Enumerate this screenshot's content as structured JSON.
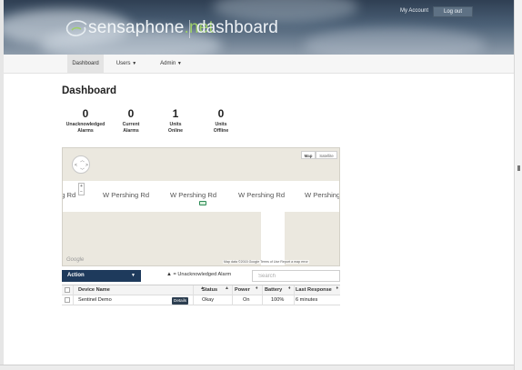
{
  "header": {
    "brand_name": "sensaphone",
    "brand_tld": ".net",
    "section": "dashboard",
    "my_account_label": "My Account",
    "logout_label": "Log out"
  },
  "nav": {
    "items": [
      {
        "label": "Dashboard",
        "active": true
      },
      {
        "label": "Users",
        "has_dropdown": true
      },
      {
        "label": "Admin",
        "has_dropdown": true
      }
    ]
  },
  "page": {
    "title": "Dashboard"
  },
  "stats": [
    {
      "value": "0",
      "label_line1": "Unacknowledged",
      "label_line2": "Alarms"
    },
    {
      "value": "0",
      "label_line1": "Current",
      "label_line2": "Alarms"
    },
    {
      "value": "1",
      "label_line1": "Units",
      "label_line2": "Online"
    },
    {
      "value": "0",
      "label_line1": "Units",
      "label_line2": "Offline"
    }
  ],
  "map": {
    "type_options": [
      "Map",
      "Satellite"
    ],
    "selected_type": "Map",
    "streets": [
      "ng Rd",
      "W Pershing Rd",
      "W Pershing Rd",
      "W Pershing Rd",
      "W Pershing"
    ],
    "provider_logo": "Google",
    "footer": "Map data ©2015 Google   Terms of Use   Report a map error",
    "zoom_in": "+",
    "zoom_out": "−"
  },
  "toolbar": {
    "action_label": "Action",
    "legend_symbol": "▲",
    "legend_text": "= Unacknowledged Alarm",
    "search_placeholder": "Search"
  },
  "table": {
    "columns": [
      "Device Name",
      "Status",
      "Power",
      "Battery",
      "Last Response"
    ],
    "rows": [
      {
        "device": "Sentinel Demo",
        "details_label": "Details",
        "status": "Okay",
        "power": "On",
        "battery": "100%",
        "last_response": "6 minutes"
      }
    ]
  },
  "colors": {
    "brand_accent": "#9fd06a",
    "action_button": "#1e3a5c",
    "banner_dark": "#2f3f53"
  }
}
